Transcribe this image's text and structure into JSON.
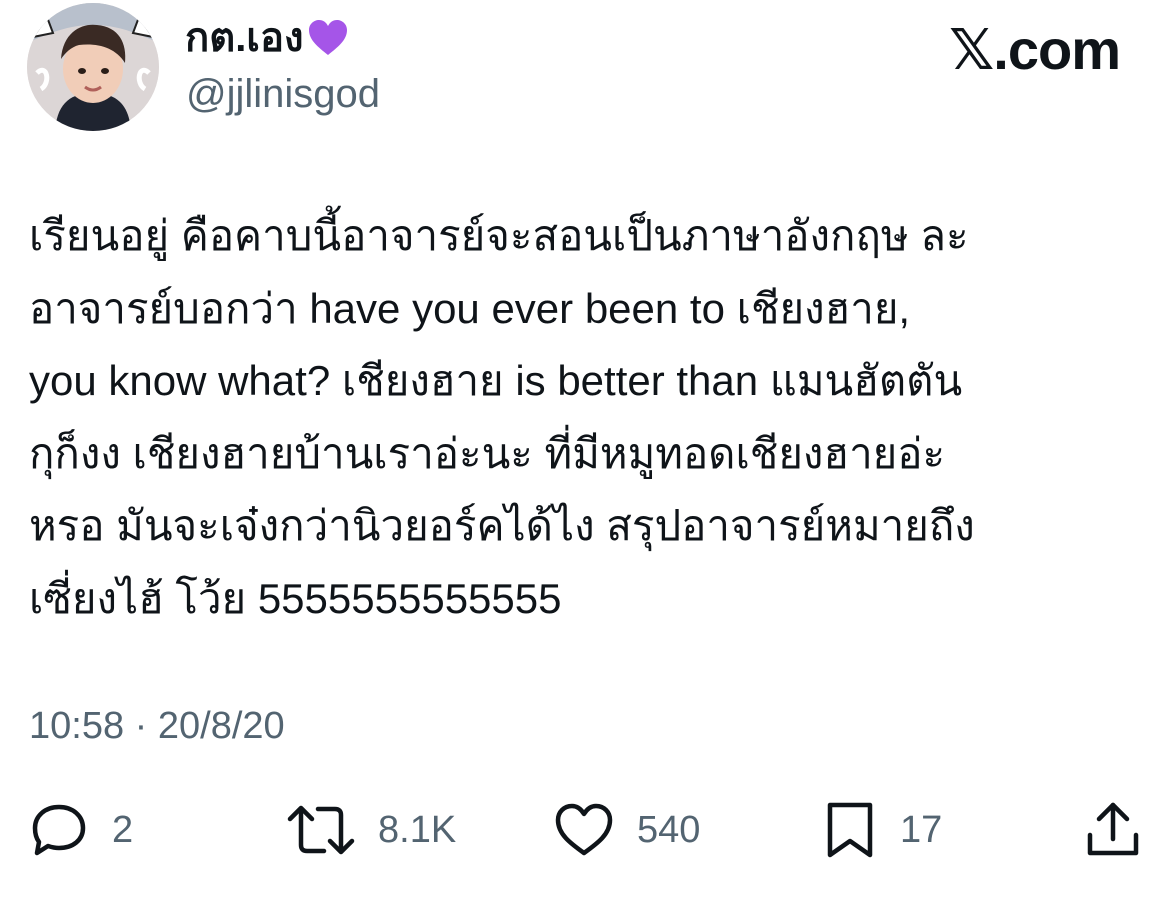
{
  "author": {
    "display_name": "กต.เอง",
    "handle": "@jjlinisgod",
    "name_emoji_icon": "purple-heart-icon",
    "accent_color": "#a555e8"
  },
  "brand": {
    "label": "𝕏.com"
  },
  "tweet": {
    "lines": [
      "เรียนอยู่ คือคาบนี้อาจารย์จะสอนเป็นภาษาอังกฤษ ละ",
      "อาจารย์บอกว่า have you ever been to เชียงฮาย,",
      "you know what? เชียงฮาย is better than แมนฮัตตัน",
      "กุก็งง เชียงฮายบ้านเราอ่ะนะ ที่มีหมูทอดเชียงฮายอ่ะ",
      "หรอ มันจะเจ๋งกว่านิวยอร์คได้ไง สรุปอาจารย์หมายถึง",
      "เซี่ยงไฮ้ โว้ย 5555555555555"
    ],
    "timestamp": "10:58 · 20/8/20"
  },
  "actions": {
    "reply": {
      "icon": "reply-bubble-icon",
      "count": "2"
    },
    "retweet": {
      "icon": "retweet-icon",
      "count": "8.1K"
    },
    "like": {
      "icon": "heart-outline-icon",
      "count": "540"
    },
    "bookmark": {
      "icon": "bookmark-icon",
      "count": "17"
    },
    "share": {
      "icon": "share-upload-icon"
    }
  },
  "colors": {
    "text": "#0f1419",
    "muted": "#536471",
    "background": "#ffffff"
  }
}
